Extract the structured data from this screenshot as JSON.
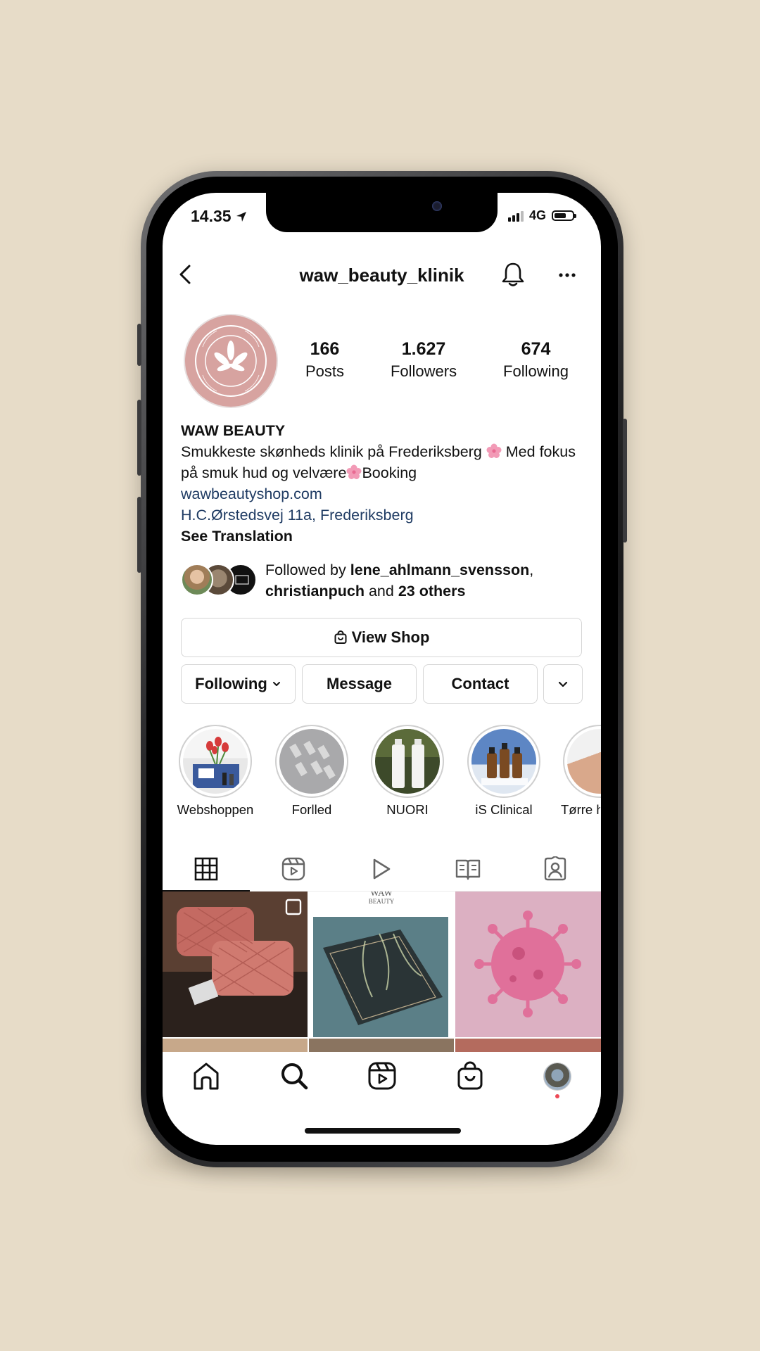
{
  "status_bar": {
    "time": "14.35",
    "network": "4G"
  },
  "header": {
    "username": "waw_beauty_klinik"
  },
  "stats": [
    {
      "value": "166",
      "label": "Posts"
    },
    {
      "value": "1.627",
      "label": "Followers"
    },
    {
      "value": "674",
      "label": "Following"
    }
  ],
  "bio": {
    "name": "WAW BEAUTY",
    "text_1": "Smukkeste skønheds klinik på Frederiksberg",
    "text_2": "Med fokus på smuk hud og velvære",
    "text_3": "Booking",
    "link": "wawbeautyshop.com",
    "address": "H.C.Ørstedsvej 11a, Frederiksberg",
    "see_translation": "See Translation"
  },
  "followed_by": {
    "prefix": "Followed by",
    "user_1": "lene_ahlmann_svensson",
    "separator": ",",
    "user_2": "christianpuch",
    "middle": "and",
    "others": "23 others"
  },
  "buttons": {
    "view_shop": "View Shop",
    "following": "Following",
    "message": "Message",
    "contact": "Contact"
  },
  "highlights": [
    {
      "label": "Webshoppen"
    },
    {
      "label": "Forlled"
    },
    {
      "label": "NUORI"
    },
    {
      "label": "iS Clinical"
    },
    {
      "label": "Tørre h"
    }
  ],
  "post_texts": {
    "brand_top": "WAW",
    "brand_sub": "BEAUTY"
  },
  "colors": {
    "accent_link": "#1f3b63",
    "avatar_pink": "#d7a3a0",
    "notification_dot": "#ed4956"
  },
  "tabs": [
    {
      "icon": "grid-icon"
    },
    {
      "icon": "reels-icon"
    },
    {
      "icon": "video-play-icon"
    },
    {
      "icon": "guides-icon"
    },
    {
      "icon": "tagged-icon"
    }
  ],
  "bottom_nav": [
    {
      "icon": "home-icon"
    },
    {
      "icon": "search-icon"
    },
    {
      "icon": "reels-icon"
    },
    {
      "icon": "shop-bag-icon"
    },
    {
      "icon": "profile-avatar"
    }
  ]
}
